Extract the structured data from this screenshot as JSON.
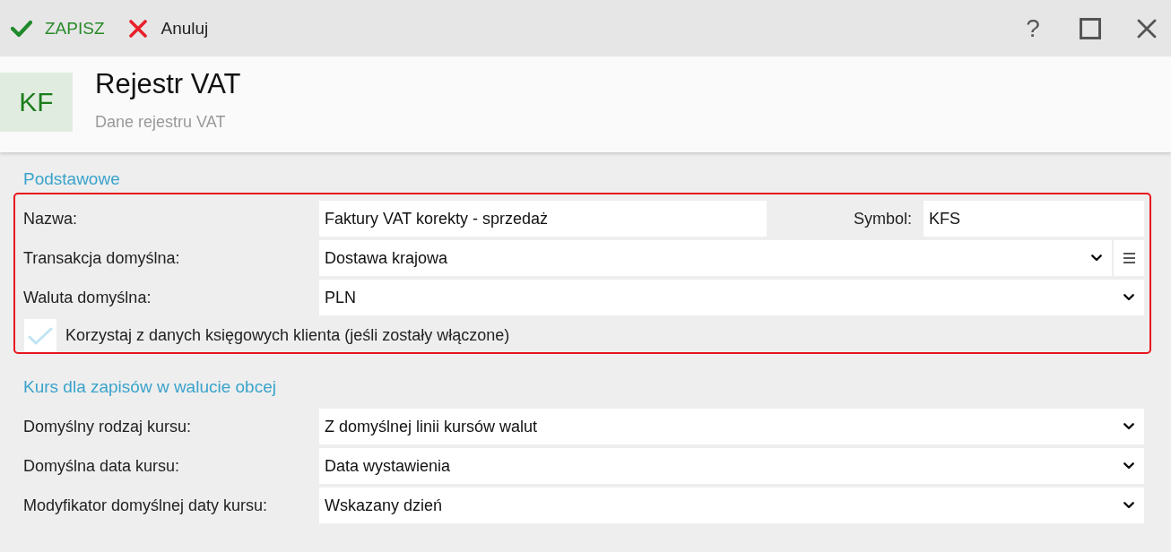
{
  "toolbar": {
    "actions": [
      {
        "kind": "save",
        "label": "ZAPISZ"
      },
      {
        "kind": "cancel",
        "label": "Anuluj"
      }
    ],
    "window_buttons": [
      {
        "kind": "help",
        "label": "?"
      },
      {
        "kind": "maximize"
      },
      {
        "kind": "close"
      }
    ]
  },
  "header": {
    "badge": "KF",
    "title": "Rejestr VAT",
    "subtitle": "Dane rejestru VAT"
  },
  "sections": [
    {
      "title": "Podstawowe",
      "highlighted": true,
      "rows": [
        {
          "kind": "text_pair",
          "label": "Nazwa:",
          "value": "Faktury VAT korekty - sprzedaż",
          "second_label": "Symbol:",
          "second_value": "KFS"
        },
        {
          "kind": "dropdown",
          "label": "Transakcja domyślna:",
          "value": "Dostawa krajowa",
          "list_button": true
        },
        {
          "kind": "dropdown",
          "label": "Waluta domyślna:",
          "value": "PLN",
          "list_button": false
        },
        {
          "kind": "checkbox",
          "label": "Korzystaj z danych księgowych klienta (jeśli zostały włączone)",
          "checked": true,
          "disabled": true
        }
      ]
    },
    {
      "title": "Kurs dla zapisów w walucie obcej",
      "highlighted": false,
      "rows": [
        {
          "kind": "dropdown",
          "label": "Domyślny rodzaj kursu:",
          "value": "Z domyślnej linii kursów walut",
          "list_button": false
        },
        {
          "kind": "dropdown",
          "label": "Domyślna data kursu:",
          "value": "Data wystawienia",
          "list_button": false
        },
        {
          "kind": "dropdown",
          "label": "Modyfikator domyślnej daty kursu:",
          "value": "Wskazany dzień",
          "list_button": false
        }
      ]
    }
  ]
}
